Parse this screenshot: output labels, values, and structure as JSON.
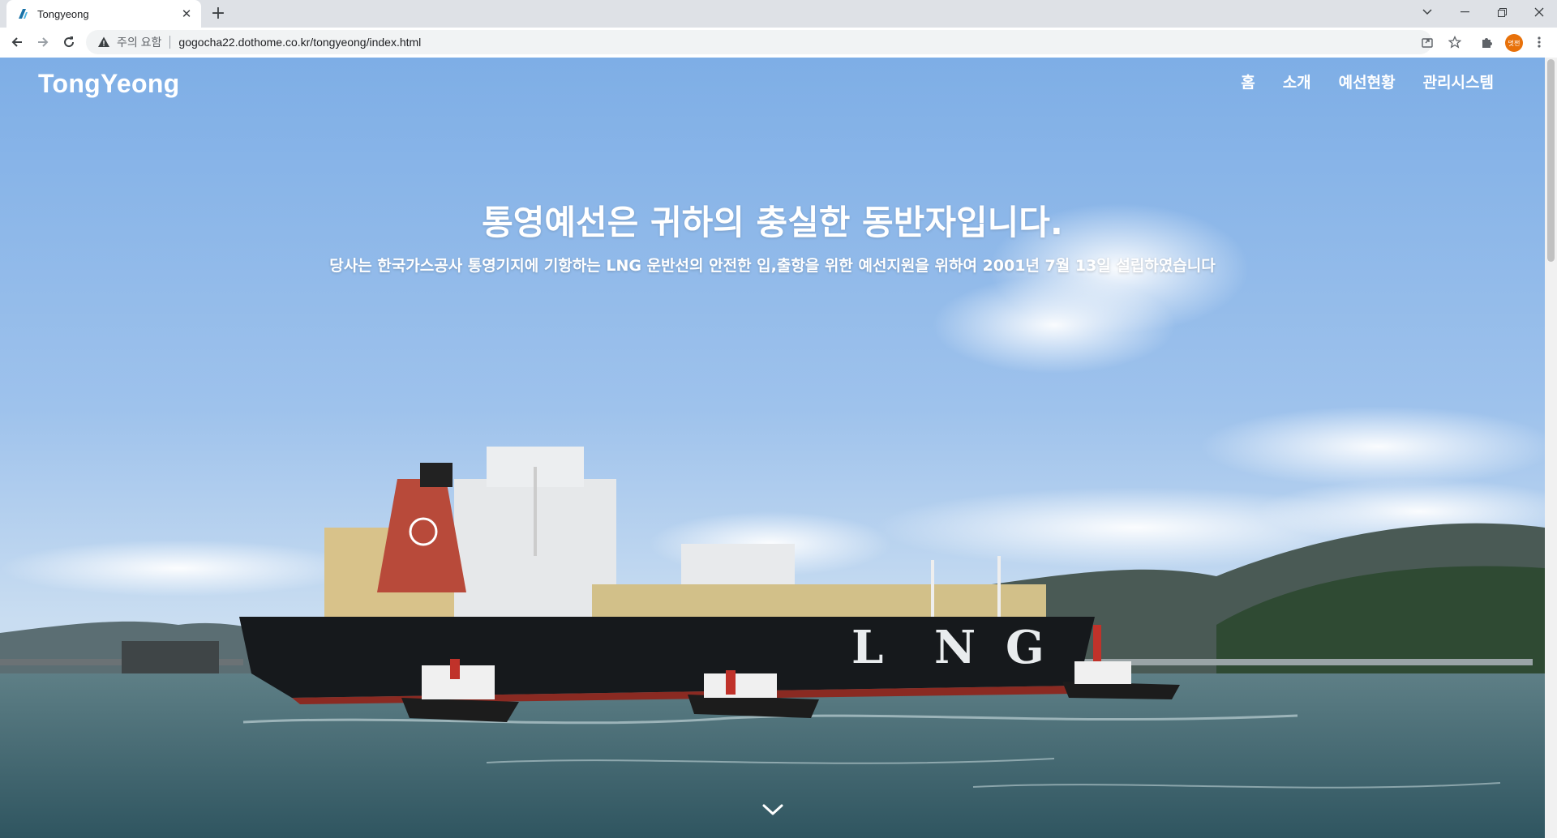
{
  "browser": {
    "tab_title": "Tongyeong",
    "security_label": "주의 요함",
    "url": "gogocha22.dothome.co.kr/tongyeong/index.html",
    "profile_label": "멋쩐"
  },
  "site": {
    "logo": "TongYeong",
    "nav": [
      "홈",
      "소개",
      "예선현황",
      "관리시스템"
    ],
    "headline": "통영예선은 귀하의 충실한 동반자입니다.",
    "subline": "당사는 한국가스공사 통영기지에 기항하는 LNG 운반선의 안전한 입,출항을 위한 예선지원을 위하여 2001년 7월 13일 설립하였습니다",
    "hull_letters": [
      "L",
      "N",
      "G"
    ]
  },
  "icons": {
    "back": "arrow-left-icon",
    "forward": "arrow-right-icon",
    "reload": "reload-icon",
    "warning": "warning-triangle-icon",
    "share": "share-icon",
    "bookmark": "star-icon",
    "extensions": "puzzle-icon",
    "menu": "kebab-menu-icon",
    "scroll_down": "chevron-down-icon"
  }
}
